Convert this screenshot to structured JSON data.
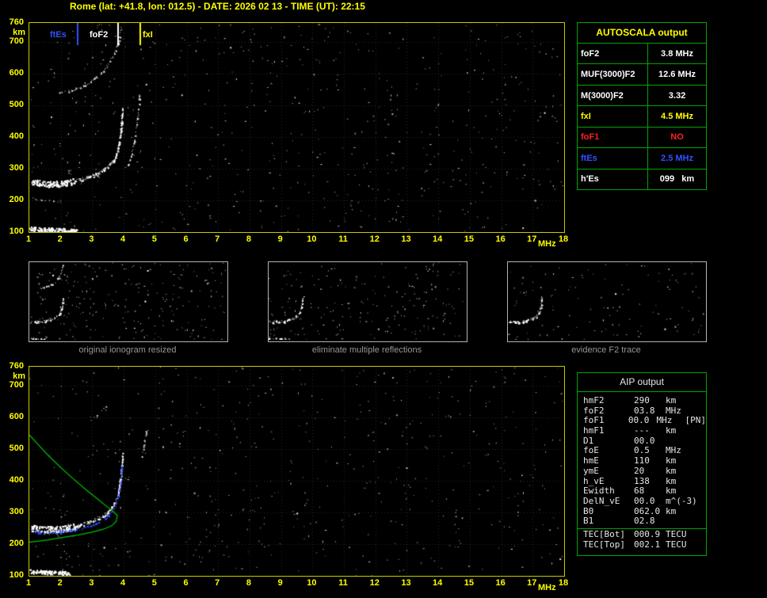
{
  "header": {
    "title": "Rome (lat: +41.8, lon: 012.5) - DATE: 2026 02 13 - TIME (UT): 22:15"
  },
  "top_plot": {
    "y_unit": "km",
    "x_unit": "MHz",
    "y_ticks": [
      760,
      700,
      600,
      500,
      400,
      300,
      200,
      100
    ],
    "x_ticks": [
      1,
      2,
      3,
      4,
      5,
      6,
      7,
      8,
      9,
      10,
      11,
      12,
      13,
      14,
      15,
      16,
      17,
      18
    ],
    "legend": [
      {
        "label": "ftEs",
        "freq_mhz": 2.5,
        "color": "#3350ff"
      },
      {
        "label": "foF2",
        "freq_mhz": 3.8,
        "color": "#ffffff"
      },
      {
        "label": "fxI",
        "freq_mhz": 4.5,
        "color": "#ffff00"
      }
    ]
  },
  "bottom_plot": {
    "y_unit": "km",
    "x_unit": "MHz",
    "y_ticks": [
      760,
      700,
      600,
      500,
      400,
      300,
      200,
      100
    ],
    "x_ticks": [
      1,
      2,
      3,
      4,
      5,
      6,
      7,
      8,
      9,
      10,
      11,
      12,
      13,
      14,
      15,
      16,
      17,
      18
    ]
  },
  "autoscala_table": {
    "title": "AUTOSCALA output",
    "rows": [
      {
        "label": "foF2",
        "value": "3.8 MHz",
        "color": "#ffffff"
      },
      {
        "label": "MUF(3000)F2",
        "value": "12.6 MHz",
        "color": "#ffffff"
      },
      {
        "label": "M(3000)F2",
        "value": "3.32",
        "color": "#ffffff"
      },
      {
        "label": "fxI",
        "value": "4.5 MHz",
        "color": "#ffff00"
      },
      {
        "label": "foF1",
        "value": "NO",
        "color": "#ff2020"
      },
      {
        "label": "ftEs",
        "value": "2.5 MHz",
        "color": "#3350ff"
      },
      {
        "label": "h'Es",
        "value": "099   km",
        "color": "#ffffff"
      }
    ]
  },
  "thumbnails": [
    {
      "caption": "original ionogram resized"
    },
    {
      "caption": "eliminate multiple reflections"
    },
    {
      "caption": "evidence F2 trace"
    }
  ],
  "aip_table": {
    "title": "AIP output",
    "rows": [
      {
        "name": "hmF2",
        "value": "290",
        "unit": "km",
        "extra": ""
      },
      {
        "name": "foF2",
        "value": "03.8",
        "unit": "MHz",
        "extra": ""
      },
      {
        "name": "foF1",
        "value": "00.0",
        "unit": "MHz",
        "extra": "[PN]"
      },
      {
        "name": "hmF1",
        "value": "---",
        "unit": "km",
        "extra": ""
      },
      {
        "name": "D1",
        "value": "00.0",
        "unit": "",
        "extra": ""
      },
      {
        "name": "foE",
        "value": "0.5",
        "unit": "MHz",
        "extra": ""
      },
      {
        "name": "hmE",
        "value": "110",
        "unit": "km",
        "extra": ""
      },
      {
        "name": "ymE",
        "value": "20",
        "unit": "km",
        "extra": ""
      },
      {
        "name": "h_vE",
        "value": "138",
        "unit": "km",
        "extra": ""
      },
      {
        "name": "Ewidth",
        "value": "68",
        "unit": "km",
        "extra": ""
      },
      {
        "name": "DelN_vE",
        "value": "00.0",
        "unit": "m^(-3)",
        "extra": ""
      },
      {
        "name": "B0",
        "value": "062.0",
        "unit": "km",
        "extra": ""
      },
      {
        "name": "B1",
        "value": "02.8",
        "unit": "",
        "extra": ""
      }
    ],
    "tec_rows": [
      {
        "name": "TEC[Bot]",
        "value": "000.9",
        "unit": "TECU"
      },
      {
        "name": "TEC[Top]",
        "value": "002.1",
        "unit": "TECU"
      }
    ]
  },
  "colors": {
    "axis_yellow": "#ffff00",
    "table_green": "#00a400",
    "ftes_blue": "#3350ff",
    "fof1_red": "#ff2020",
    "profile_green": "#00c000",
    "caption_gray": "#969696"
  },
  "chart_data": [
    {
      "id": "ionogram-top",
      "type": "scatter",
      "title": "recorded ionogram with AUTOSCALA frequency markers",
      "xlabel": "MHz",
      "ylabel": "km",
      "x_range": [
        1,
        18
      ],
      "y_range": [
        100,
        760
      ],
      "grid": true,
      "noise": {
        "count": 620,
        "seed": 1234
      },
      "markers": [
        {
          "name": "ftEs",
          "freq": 2.5,
          "color": "#3350ff"
        },
        {
          "name": "foF2",
          "freq": 3.8,
          "color": "#ffffff"
        },
        {
          "name": "fxI",
          "freq": 4.5,
          "color": "#ffff00"
        }
      ],
      "traces": [
        {
          "name": "Es-layer",
          "color": "#ffffff",
          "width": 3,
          "density": 2.0,
          "points": [
            [
              1.0,
              112
            ],
            [
              1.6,
              109
            ],
            [
              2.2,
              107
            ],
            [
              2.5,
              106
            ]
          ]
        },
        {
          "name": "F2-trace-start",
          "color": "#ffffff",
          "width": 5,
          "density": 2.2,
          "points": [
            [
              1.05,
              258
            ],
            [
              1.5,
              252
            ],
            [
              2.0,
              254
            ],
            [
              2.45,
              262
            ]
          ]
        },
        {
          "name": "F2-ordinary",
          "color": "#ffffff",
          "width": 2.5,
          "density": 1.4,
          "points": [
            [
              2.45,
              262
            ],
            [
              2.9,
              274
            ],
            [
              3.25,
              289
            ],
            [
              3.5,
              306
            ],
            [
              3.68,
              328
            ],
            [
              3.8,
              358
            ],
            [
              3.88,
              400
            ],
            [
              3.93,
              450
            ],
            [
              3.96,
              490
            ]
          ]
        },
        {
          "name": "F2-extraordinary",
          "color": "#dddddd",
          "width": 1.5,
          "density": 0.5,
          "points": [
            [
              4.1,
              300
            ],
            [
              4.25,
              345
            ],
            [
              4.35,
              400
            ],
            [
              4.45,
              470
            ],
            [
              4.5,
              540
            ]
          ]
        },
        {
          "name": "F2-second-hop",
          "color": "#dddddd",
          "width": 1.5,
          "density": 0.55,
          "points": [
            [
              1.9,
              540
            ],
            [
              2.35,
              548
            ],
            [
              2.8,
              566
            ],
            [
              3.2,
              594
            ],
            [
              3.5,
              628
            ],
            [
              3.7,
              665
            ],
            [
              3.85,
              710
            ],
            [
              3.93,
              752
            ]
          ]
        },
        {
          "name": "weak-echo",
          "color": "#bbbbbb",
          "width": 1.5,
          "density": 0.3,
          "points": [
            [
              1.0,
              205
            ],
            [
              1.6,
              200
            ],
            [
              2.1,
              198
            ]
          ]
        }
      ]
    },
    {
      "id": "ionogram-bottom",
      "type": "scatter",
      "title": "restored ionogram with identified trace and electron density profile",
      "xlabel": "MHz",
      "ylabel": "km",
      "x_range": [
        1,
        18
      ],
      "y_range": [
        100,
        760
      ],
      "grid": true,
      "noise": {
        "count": 560,
        "seed": 5678
      },
      "markers": [],
      "traces": [
        {
          "name": "Es-layer",
          "color": "#ffffff",
          "width": 3,
          "density": 1.8,
          "points": [
            [
              1.0,
              115
            ],
            [
              1.6,
              112
            ],
            [
              2.3,
              110
            ]
          ]
        },
        {
          "name": "F2-trace-start",
          "color": "#ffffff",
          "width": 5,
          "density": 2.2,
          "points": [
            [
              1.05,
              252
            ],
            [
              1.5,
              247
            ],
            [
              2.0,
              249
            ],
            [
              2.45,
              257
            ]
          ]
        },
        {
          "name": "F2-ordinary",
          "color": "#ffffff",
          "width": 2.5,
          "density": 1.4,
          "points": [
            [
              2.45,
              257
            ],
            [
              2.9,
              269
            ],
            [
              3.25,
              284
            ],
            [
              3.5,
              301
            ],
            [
              3.68,
              323
            ],
            [
              3.8,
              353
            ],
            [
              3.88,
              395
            ],
            [
              3.93,
              445
            ],
            [
              3.96,
              485
            ]
          ]
        },
        {
          "name": "identified-F2-trace",
          "color": "#3350ff",
          "width": 2,
          "density": 1.0,
          "points": [
            [
              1.1,
              240
            ],
            [
              1.6,
              237
            ],
            [
              2.1,
              240
            ],
            [
              2.6,
              248
            ],
            [
              3.0,
              260
            ],
            [
              3.3,
              275
            ],
            [
              3.55,
              295
            ],
            [
              3.72,
              320
            ],
            [
              3.83,
              355
            ],
            [
              3.9,
              400
            ],
            [
              3.94,
              450
            ]
          ]
        },
        {
          "name": "second-hop-remnant",
          "color": "#bbbbbb",
          "width": 1.5,
          "density": 0.3,
          "points": [
            [
              2.9,
              588
            ],
            [
              3.2,
              610
            ],
            [
              3.45,
              638
            ]
          ]
        },
        {
          "name": "x-trace-remnant",
          "color": "#cccccc",
          "width": 1.5,
          "density": 0.4,
          "points": [
            [
              4.55,
              470
            ],
            [
              4.65,
              520
            ],
            [
              4.72,
              568
            ]
          ]
        }
      ],
      "lines": [
        {
          "name": "electron-density-profile",
          "color": "#00c000",
          "width": 1.2,
          "points": [
            [
              1.0,
              545
            ],
            [
              1.3,
              512
            ],
            [
              1.6,
              480
            ],
            [
              2.0,
              442
            ],
            [
              2.4,
              406
            ],
            [
              2.8,
              372
            ],
            [
              3.2,
              340
            ],
            [
              3.5,
              316
            ],
            [
              3.7,
              300
            ],
            [
              3.8,
              290
            ],
            [
              3.76,
              272
            ],
            [
              3.62,
              258
            ],
            [
              3.35,
              247
            ],
            [
              3.0,
              238
            ],
            [
              2.55,
              229
            ],
            [
              2.05,
              221
            ],
            [
              1.55,
              213
            ],
            [
              1.0,
              206
            ]
          ]
        }
      ]
    },
    {
      "id": "thumb-original",
      "type": "scatter",
      "title": "original ionogram resized",
      "x_range": [
        1,
        18
      ],
      "y_range": [
        100,
        760
      ],
      "grid": false,
      "noise": {
        "count": 240,
        "seed": 4242
      },
      "markers": [],
      "traces": [
        {
          "name": "Es",
          "color": "#ffffff",
          "width": 1.5,
          "density": 0.8,
          "points": [
            [
              1.0,
              112
            ],
            [
              2.4,
              107
            ]
          ]
        },
        {
          "name": "F2",
          "color": "#ffffff",
          "width": 2,
          "density": 1.1,
          "points": [
            [
              1.05,
              255
            ],
            [
              2.0,
              252
            ],
            [
              2.9,
              272
            ],
            [
              3.4,
              298
            ],
            [
              3.7,
              330
            ],
            [
              3.85,
              390
            ],
            [
              3.93,
              460
            ]
          ]
        },
        {
          "name": "second-hop",
          "color": "#dddddd",
          "width": 1.5,
          "density": 0.6,
          "points": [
            [
              1.9,
              540
            ],
            [
              2.8,
              566
            ],
            [
              3.3,
              602
            ],
            [
              3.6,
              640
            ],
            [
              3.8,
              690
            ],
            [
              3.92,
              745
            ]
          ]
        }
      ]
    },
    {
      "id": "thumb-multiples",
      "type": "scatter",
      "title": "eliminate multiple reflections",
      "x_range": [
        1,
        18
      ],
      "y_range": [
        100,
        760
      ],
      "grid": false,
      "noise": {
        "count": 200,
        "seed": 5151
      },
      "markers": [],
      "traces": [
        {
          "name": "Es",
          "color": "#ffffff",
          "width": 1.5,
          "density": 0.8,
          "points": [
            [
              1.0,
              112
            ],
            [
              2.4,
              107
            ]
          ]
        },
        {
          "name": "F2",
          "color": "#ffffff",
          "width": 2,
          "density": 1.1,
          "points": [
            [
              1.05,
              255
            ],
            [
              2.0,
              252
            ],
            [
              2.9,
              272
            ],
            [
              3.4,
              298
            ],
            [
              3.7,
              330
            ],
            [
              3.85,
              390
            ],
            [
              3.93,
              460
            ]
          ]
        }
      ]
    },
    {
      "id": "thumb-evidence",
      "type": "scatter",
      "title": "evidence F2 trace",
      "x_range": [
        1,
        18
      ],
      "y_range": [
        100,
        760
      ],
      "grid": false,
      "noise": {
        "count": 120,
        "seed": 6161
      },
      "markers": [],
      "traces": [
        {
          "name": "F2",
          "color": "#ffffff",
          "width": 2,
          "density": 1.3,
          "points": [
            [
              1.05,
              255
            ],
            [
              2.0,
              252
            ],
            [
              2.9,
              272
            ],
            [
              3.4,
              298
            ],
            [
              3.7,
              330
            ],
            [
              3.85,
              390
            ],
            [
              3.93,
              460
            ]
          ]
        }
      ]
    }
  ]
}
